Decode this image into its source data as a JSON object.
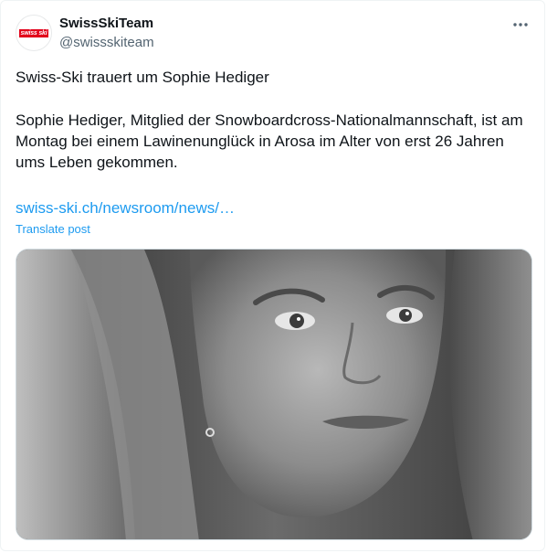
{
  "author": {
    "display_name": "SwissSkiTeam",
    "handle": "@swissskiteam",
    "avatar_logo_text": "swiss ski",
    "avatar_color": "#e2001a"
  },
  "post": {
    "headline": "Swiss-Ski trauert um Sophie Hediger",
    "body": "Sophie Hediger, Mitglied der Snowboardcross-Nationalmannschaft, ist am Montag bei einem Lawinenunglück in Arosa im Alter von erst 26 Jahren ums Leben gekommen.",
    "link_text": "swiss-ski.ch/newsroom/news/…",
    "translate_label": "Translate post"
  },
  "icons": {
    "more": "more-horizontal-icon"
  },
  "colors": {
    "link": "#1d9bf0",
    "text": "#0f1419",
    "secondary": "#536471"
  }
}
